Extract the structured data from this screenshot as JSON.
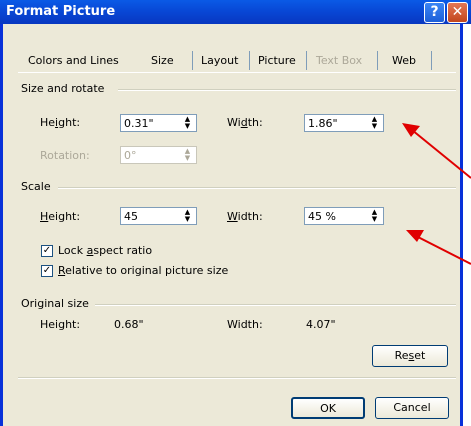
{
  "window": {
    "title": "Format Picture",
    "help_glyph": "?",
    "close_glyph": "✕"
  },
  "tabs": [
    {
      "label": "Colors and Lines"
    },
    {
      "label": "Size"
    },
    {
      "label": "Layout"
    },
    {
      "label": "Picture"
    },
    {
      "label": "Text Box"
    },
    {
      "label": "Web"
    }
  ],
  "size_rotate": {
    "section": "Size and rotate",
    "height_label_pre": "He",
    "height_label_acc": "i",
    "height_label_post": "ght:",
    "height_value": "0.31\"",
    "width_label_pre": "Wi",
    "width_label_acc": "d",
    "width_label_post": "th:",
    "width_value": "1.86\"",
    "rotation_label": "Rotation:",
    "rotation_value": "0°"
  },
  "scale": {
    "section": "Scale",
    "height_label_acc": "H",
    "height_label_post": "eight:",
    "height_value": "45",
    "width_label_acc": "W",
    "width_label_post": "idth:",
    "width_value": "45 %",
    "lock_pre": "Lock ",
    "lock_acc": "a",
    "lock_post": "spect ratio",
    "relative_acc": "R",
    "relative_post": "elative to original picture size"
  },
  "original_size": {
    "section": "Original size",
    "height_label": "Height:",
    "height_value": "0.68\"",
    "width_label": "Width:",
    "width_value": "4.07\""
  },
  "buttons": {
    "reset_pre": "Re",
    "reset_acc": "s",
    "reset_post": "et",
    "ok": "OK",
    "cancel": "Cancel"
  },
  "colors": {
    "annotation_arrow": "#e00000",
    "title_bar": "#0846d4"
  }
}
